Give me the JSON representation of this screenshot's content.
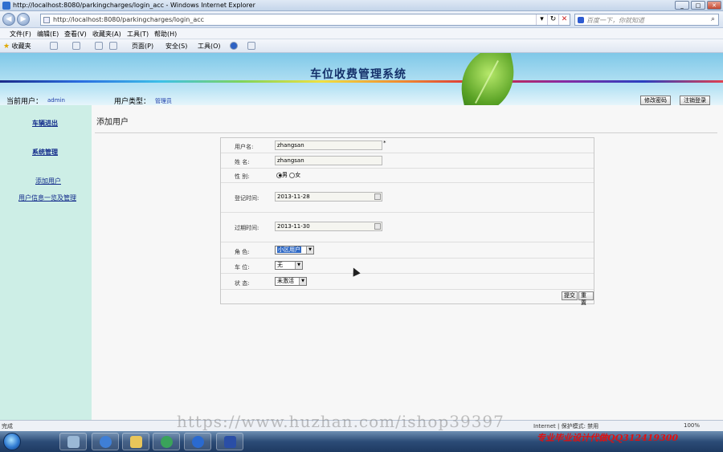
{
  "browser": {
    "window_title": "http://localhost:8080/parkingcharges/login_acc - Windows Internet Explorer",
    "url": "http://localhost:8080/parkingcharges/login_acc",
    "search_placeholder": "百度一下，你就知道",
    "menu": [
      "文件(F)",
      "编辑(E)",
      "查看(V)",
      "收藏夹(A)",
      "工具(T)",
      "帮助(H)"
    ],
    "favorites_label": "收藏夹",
    "toolbar": [
      "页面(P)",
      "安全(S)",
      "工具(O)"
    ]
  },
  "header": {
    "system_title": "车位收费管理系统",
    "current_user_label": "当前用户：",
    "current_user": "admin",
    "user_type_label": "用户类型：",
    "user_type": "管理员",
    "change_password": "修改密码",
    "logout": "注销登录"
  },
  "sidebar": {
    "items": [
      {
        "label": "车辆进出"
      },
      {
        "label": "系统管理"
      },
      {
        "label": "添加用户"
      },
      {
        "label": "用户信息一览及管理"
      }
    ]
  },
  "main": {
    "page_title": "添加用户",
    "form": {
      "username_label": "用户名:",
      "username_value": "zhangsan",
      "required_mark": "*",
      "name_label": "姓 名:",
      "name_value": "zhangsan",
      "gender_label": "性 别:",
      "gender_male": "男",
      "gender_female": "女",
      "register_time_label": "登记时间:",
      "register_time_value": "2013-11-28",
      "expire_time_label": "过期时间:",
      "expire_time_value": "2013-11-30",
      "role_label": "角 色:",
      "role_value": "小区用户",
      "spot_label": "车 位:",
      "spot_value": "无",
      "status_label": "状 态:",
      "status_value": "未激活",
      "submit": "提交",
      "reset": "重置"
    }
  },
  "statusbar": {
    "left": "完成",
    "zone": "Internet | 保护模式: 禁用",
    "zoom": "100%"
  },
  "overlays": {
    "watermark": "https://www.huzhan.com/ishop39397",
    "promo": "专业毕业设计代做QQ312419300"
  }
}
